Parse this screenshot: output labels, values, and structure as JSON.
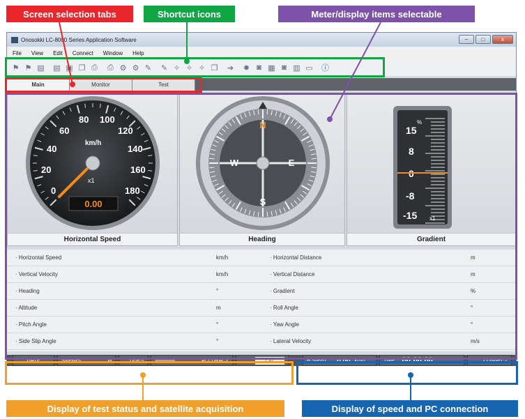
{
  "callouts": {
    "screen_tabs": "Screen selection tabs",
    "shortcut_icons": "Shortcut icons",
    "meter_items": "Meter/display items selectable",
    "test_status": "Display of test status and satellite acquisition",
    "speed_connection": "Display of speed and PC connection"
  },
  "colors": {
    "red": "#e8262c",
    "green": "#10a646",
    "purple": "#7d52a8",
    "orange": "#f0a02a",
    "blue": "#1565b0",
    "needle": "#f08c1e"
  },
  "window": {
    "title": "Onosokki LC-8000 Series Application Software",
    "controls": [
      "–",
      "□",
      "x"
    ]
  },
  "menu": [
    "File",
    "View",
    "Edit",
    "Connect",
    "Window",
    "Help"
  ],
  "toolbar_icons": [
    "flag-icon",
    "flag-icon",
    "document-icon",
    "document-icon",
    "folder-icon",
    "copy-icon",
    "print-icon",
    "print-icon",
    "gear-icon",
    "gear-icon",
    "pencil-icon",
    "pencil-icon",
    "wand-icon",
    "wand-icon",
    "wand-icon",
    "copy-icon",
    "arrow-icon",
    "settings-icon",
    "camera-icon",
    "calculator-icon",
    "camera-icon",
    "chart-icon",
    "monitor-icon",
    "info-icon"
  ],
  "tabs": [
    "Main",
    "Monitor",
    "Test"
  ],
  "speedometer": {
    "ticks": [
      "0",
      "20",
      "40",
      "60",
      "80",
      "100",
      "120",
      "140",
      "160",
      "180"
    ],
    "unit": "km/h",
    "multiplier": "x1",
    "readout": "0.00",
    "value": 0,
    "caption": "Horizontal Speed"
  },
  "compass": {
    "n": "N",
    "e": "E",
    "s": "S",
    "w": "W",
    "caption": "Heading"
  },
  "gradient": {
    "ticks": [
      "15",
      "8",
      "0",
      "-8",
      "-15"
    ],
    "unit": "%",
    "multiplier": "x1",
    "caption": "Gradient"
  },
  "table": {
    "left": [
      {
        "label": "Horizontal Speed",
        "unit": "km/h"
      },
      {
        "label": "Vertical Velocity",
        "unit": "km/h"
      },
      {
        "label": "Heading",
        "unit": "°"
      },
      {
        "label": "Altitude",
        "unit": "m"
      },
      {
        "label": "Pitch Angle",
        "unit": "°"
      },
      {
        "label": "Side Slip Angle",
        "unit": "°"
      }
    ],
    "right": [
      {
        "label": "Horizontal Distance",
        "unit": "m"
      },
      {
        "label": "Vertical Distance",
        "unit": "m"
      },
      {
        "label": "Gradient",
        "unit": "%"
      },
      {
        "label": "Roll Angle",
        "unit": "°"
      },
      {
        "label": "Yaw Angle",
        "unit": "°"
      },
      {
        "label": "Lateral Velocity",
        "unit": "m/s"
      }
    ]
  },
  "status": {
    "gate": "GATE",
    "satellites_label": "Satellites:",
    "satellites_value": "0",
    "dgps": "DGPS",
    "accuracy": "ACCURACY",
    "cal": "CAL",
    "hspeed_label": "H.Speed:",
    "hspeed_value": "0.00",
    "hspeed_unit": "km/h",
    "time_label": "TIME:",
    "time_value": "00:00:00",
    "connect": "CONNECT"
  }
}
